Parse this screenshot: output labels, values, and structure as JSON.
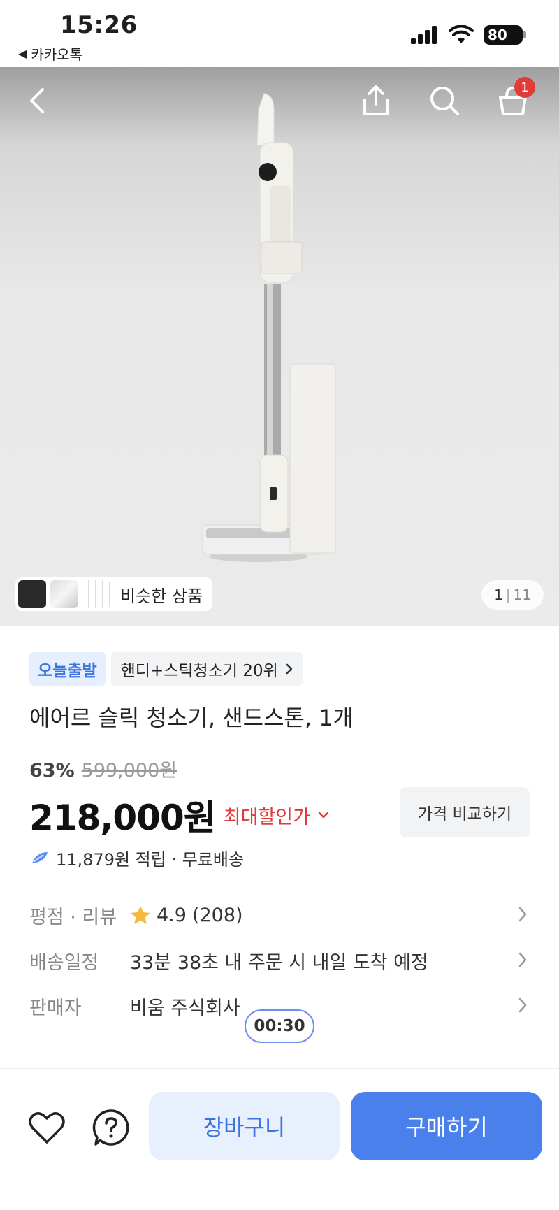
{
  "status_bar": {
    "time": "15:26",
    "back_app_label": "카카오톡",
    "battery": "80"
  },
  "hero": {
    "cart_count": "1",
    "similar_label": "비슷한 상품",
    "page_current": "1",
    "page_total": "11"
  },
  "product": {
    "tag_today": "오늘출발",
    "ranking_tag": "핸디+스틱청소기 20위",
    "title": "에어르 슬릭 청소기, 샌드스톤, 1개"
  },
  "pricing": {
    "discount_rate": "63%",
    "original_price": "599,000원",
    "sale_price": "218,000원",
    "max_discount_label": "최대할인가",
    "compare_label": "가격 비교하기",
    "points_text": "11,879원 적립 · 무료배송"
  },
  "info": {
    "rating_label": "평점 · 리뷰",
    "rating_value": "4.9",
    "review_count": "(208)",
    "delivery_label": "배송일정",
    "delivery_value": "33분 38초 내 주문 시 내일 도착 예정",
    "seller_label": "판매자",
    "seller_value": "비움 주식회사"
  },
  "timer": "00:30",
  "bottom_bar": {
    "cart_label": "장바구니",
    "buy_label": "구매하기"
  },
  "colors": {
    "accent_blue": "#4a80ec",
    "accent_red": "#e03a3a",
    "badge_red": "#e53935",
    "star": "#f5b93b"
  },
  "icons": [
    "back-arrow-icon",
    "share-icon",
    "search-icon",
    "cart-icon",
    "chevron-down-icon",
    "chevron-right-icon",
    "star-icon",
    "heart-icon",
    "help-icon",
    "points-icon",
    "signal-icon",
    "wifi-icon"
  ]
}
